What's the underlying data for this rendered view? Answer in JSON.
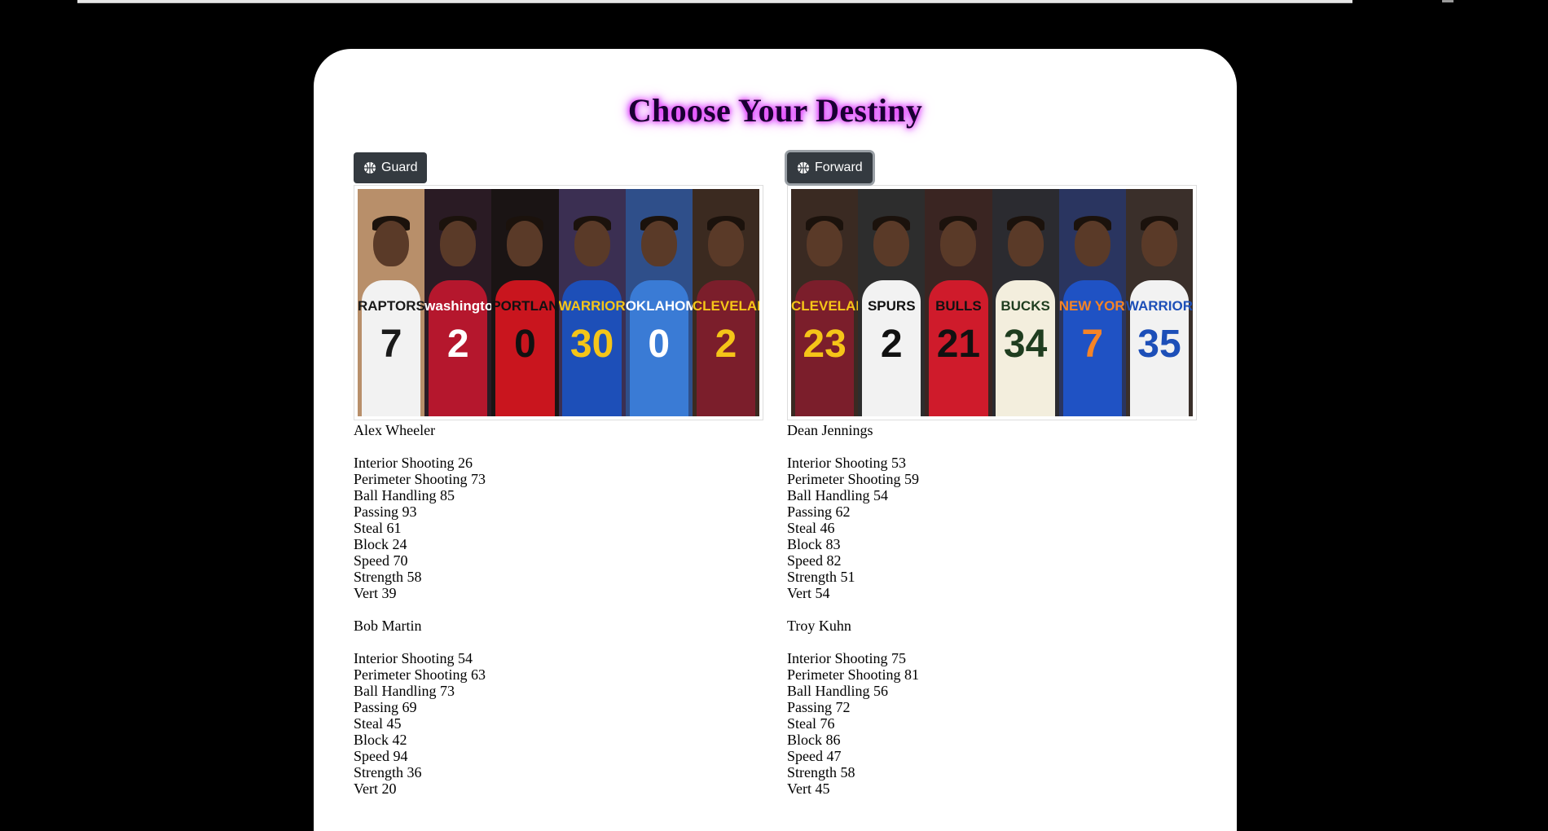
{
  "page": {
    "title": "Choose Your Destiny"
  },
  "columns": [
    {
      "button_label": "Guard",
      "icon": "basketball-icon",
      "tiles": [
        {
          "team": "RAPTORS",
          "number": "7",
          "jersey": "#f2f2f2",
          "text": "#1a1a1a",
          "bg": "#b88f6a"
        },
        {
          "team": "washington",
          "number": "2",
          "jersey": "#b5172d",
          "text": "#ffffff",
          "bg": "#2a1b24"
        },
        {
          "team": "PORTLAND",
          "number": "0",
          "jersey": "#c9151e",
          "text": "#111111",
          "bg": "#1a1414"
        },
        {
          "team": "WARRIORS",
          "number": "30",
          "jersey": "#1d4fb8",
          "text": "#f5c518",
          "bg": "#3b2f52"
        },
        {
          "team": "OKLAHOMA CITY",
          "number": "0",
          "jersey": "#3a7bd5",
          "text": "#ffffff",
          "bg": "#2f4f8a"
        },
        {
          "team": "CLEVELAND",
          "number": "2",
          "jersey": "#7b1e2b",
          "text": "#f5c518",
          "bg": "#3b2a20"
        }
      ],
      "players": [
        {
          "name": "Alex Wheeler",
          "stats": [
            "Interior Shooting 26",
            "Perimeter Shooting 73",
            "Ball Handling 85",
            "Passing 93",
            "Steal 61",
            "Block 24",
            "Speed 70",
            "Strength 58",
            "Vert 39"
          ]
        },
        {
          "name": "Bob Martin",
          "stats": [
            "Interior Shooting 54",
            "Perimeter Shooting 63",
            "Ball Handling 73",
            "Passing 69",
            "Steal 45",
            "Block 42",
            "Speed 94",
            "Strength 36",
            "Vert 20"
          ]
        }
      ]
    },
    {
      "button_label": "Forward",
      "icon": "basketball-icon",
      "tiles": [
        {
          "team": "CLEVELAND",
          "number": "23",
          "jersey": "#7b1e2b",
          "text": "#f5c518",
          "bg": "#3a2a22"
        },
        {
          "team": "SPURS",
          "number": "2",
          "jersey": "#f2f2f2",
          "text": "#111111",
          "bg": "#2d2d2d"
        },
        {
          "team": "BULLS",
          "number": "21",
          "jersey": "#cf1b2b",
          "text": "#111111",
          "bg": "#3a2522"
        },
        {
          "team": "BUCKS",
          "number": "34",
          "jersey": "#f3eedd",
          "text": "#1f3d1f",
          "bg": "#2b2b30"
        },
        {
          "team": "NEW YORK",
          "number": "7",
          "jersey": "#1f52c4",
          "text": "#f58426",
          "bg": "#2a3560"
        },
        {
          "team": "WARRIORS",
          "number": "35",
          "jersey": "#f2f2f2",
          "text": "#1d4fb8",
          "bg": "#3a2f2a"
        }
      ],
      "players": [
        {
          "name": "Dean Jennings",
          "stats": [
            "Interior Shooting 53",
            "Perimeter Shooting 59",
            "Ball Handling 54",
            "Passing 62",
            "Steal 46",
            "Block 83",
            "Speed 82",
            "Strength 51",
            "Vert 54"
          ]
        },
        {
          "name": "Troy Kuhn",
          "stats": [
            "Interior Shooting 75",
            "Perimeter Shooting 81",
            "Ball Handling 56",
            "Passing 72",
            "Steal 76",
            "Block 86",
            "Speed 47",
            "Strength 58",
            "Vert 45"
          ]
        }
      ]
    }
  ]
}
